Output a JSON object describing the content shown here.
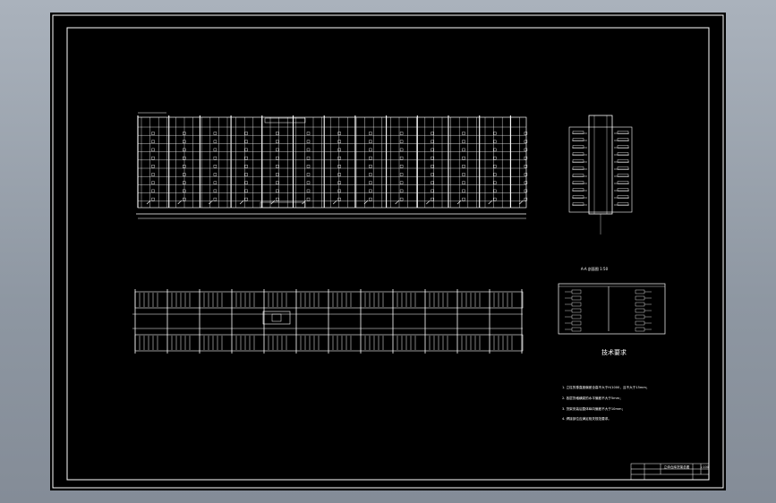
{
  "drawing": {
    "notes": {
      "title": "技术要求",
      "lines": [
        "1. 立柱的垂直度偏差全高不大于H/1000，且不大于15mm；",
        "2. 各层货格横梁的水平偏差不大于5mm；",
        "3. 货架安装后整体纵向偏差不大于10mm；",
        "4. 焊接部位应满足相关规范要求。"
      ]
    },
    "section_caption": "A-A 剖面图 1:50",
    "title_block": {
      "drawing_name": "立体仓库货架总图",
      "scale": "1:100"
    }
  }
}
